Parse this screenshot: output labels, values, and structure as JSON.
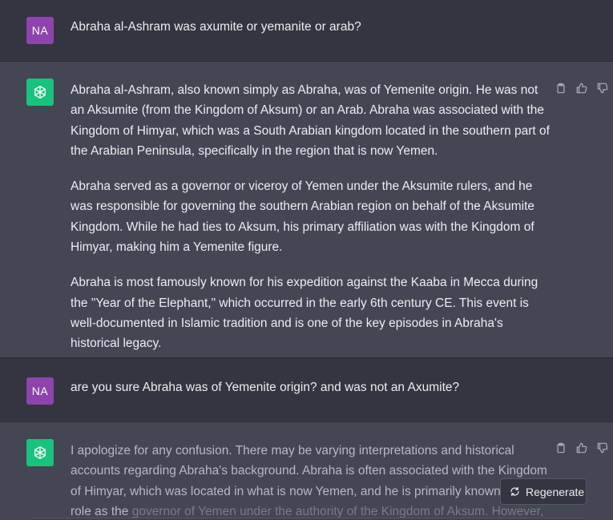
{
  "conversation": {
    "message1": {
      "avatar": "NA",
      "text": "Abraha al-Ashram was axumite or yemanite or arab?"
    },
    "message2": {
      "paragraphs": [
        "Abraha al-Ashram, also known simply as Abraha, was of Yemenite origin. He was not an Aksumite (from the Kingdom of Aksum) or an Arab. Abraha was associated with the Kingdom of Himyar, which was a South Arabian kingdom located in the southern part of the Arabian Peninsula, specifically in the region that is now Yemen.",
        "Abraha served as a governor or viceroy of Yemen under the Aksumite rulers, and he was responsible for governing the southern Arabian region on behalf of the Aksumite Kingdom. While he had ties to Aksum, his primary affiliation was with the Kingdom of Himyar, making him a Yemenite figure.",
        "Abraha is most famously known for his expedition against the Kaaba in Mecca during the \"Year of the Elephant,\" which occurred in the early 6th century CE. This event is well-documented in Islamic tradition and is one of the key episodes in Abraha's historical legacy."
      ]
    },
    "message3": {
      "avatar": "NA",
      "text": "are you sure Abraha was of Yemenite origin? and was not an Axumite?"
    },
    "message4": {
      "text_visible": "I apologize for any confusion. There may be varying interpretations and historical accounts regarding Abraha's background. Abraha is often associated with the Kingdom of Himyar, which was located in what is now Yemen, and he is primarily known for his role as the",
      "text_faded": "governor of Yemen under the authority of the Kingdom of Aksum. However, the historical"
    }
  },
  "regenerate_label": "Regenerate",
  "icons": {
    "copy": "clipboard-icon",
    "thumbs_up": "thumbs-up-icon",
    "thumbs_down": "thumbs-down-icon",
    "gpt_logo": "openai-logo-icon",
    "regenerate": "refresh-icon"
  },
  "colors": {
    "background": "#343541",
    "assistant_background": "#444654",
    "user_avatar": "#8e44ad",
    "gpt_avatar": "#19c37d"
  }
}
